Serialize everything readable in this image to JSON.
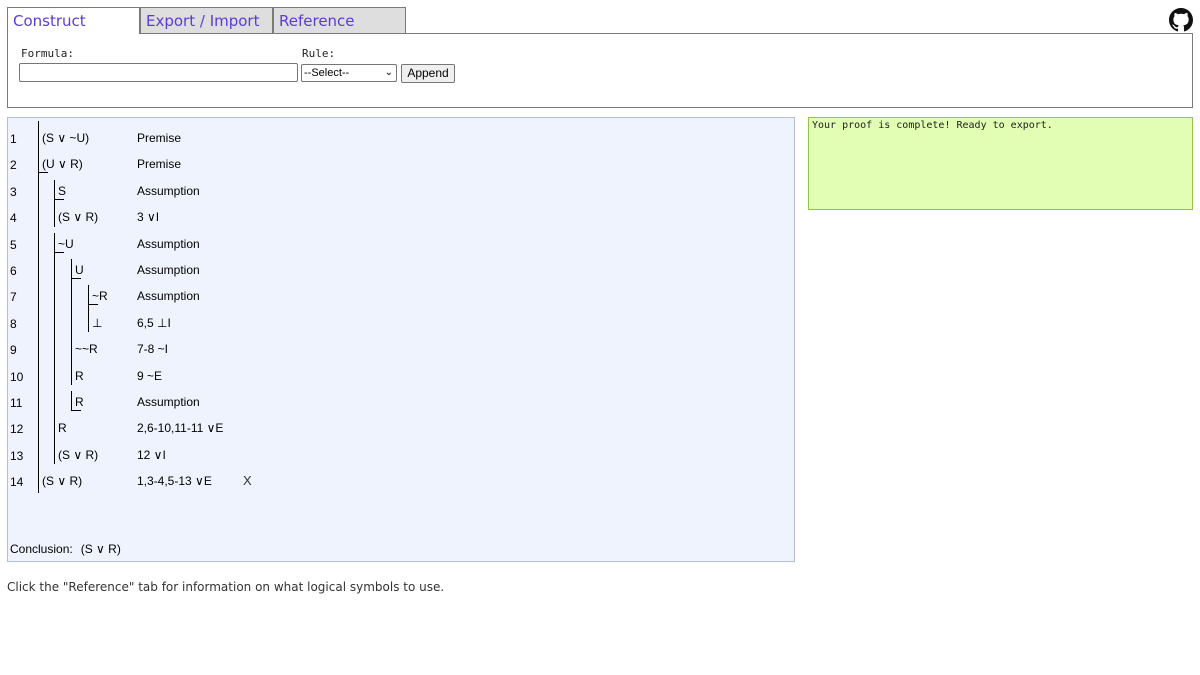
{
  "tabs": [
    {
      "label": "Construct",
      "active": true
    },
    {
      "label": "Export / Import",
      "active": false
    },
    {
      "label": "Reference",
      "active": false
    }
  ],
  "formula_panel": {
    "formula_label": "Formula:",
    "formula_value": "",
    "rule_label": "Rule:",
    "rule_selected": "--Select--",
    "append_label": "Append"
  },
  "proof": {
    "lines": [
      {
        "num": "1",
        "formula": "(S ∨ ~U)",
        "just": "Premise"
      },
      {
        "num": "2",
        "formula": "(U ∨ R)",
        "just": "Premise"
      },
      {
        "num": "3",
        "formula": "S",
        "just": "Assumption"
      },
      {
        "num": "4",
        "formula": "(S ∨ R)",
        "just": "3 ∨I"
      },
      {
        "num": "5",
        "formula": "~U",
        "just": "Assumption"
      },
      {
        "num": "6",
        "formula": "U",
        "just": "Assumption"
      },
      {
        "num": "7",
        "formula": "~R",
        "just": "Assumption"
      },
      {
        "num": "8",
        "formula": "⊥",
        "just": "6,5 ⊥I"
      },
      {
        "num": "9",
        "formula": "~~R",
        "just": "7-8 ~I"
      },
      {
        "num": "10",
        "formula": "R",
        "just": "9 ~E"
      },
      {
        "num": "11",
        "formula": "R",
        "just": "Assumption"
      },
      {
        "num": "12",
        "formula": "R",
        "just": "2,6-10,11-11 ∨E"
      },
      {
        "num": "13",
        "formula": "(S ∨ R)",
        "just": "12 ∨I"
      },
      {
        "num": "14",
        "formula": "(S ∨ R)",
        "just": "1,3-4,5-13 ∨E",
        "mark": "X"
      }
    ],
    "conclusion_label": "Conclusion:",
    "conclusion_value": "(S ∨ R)"
  },
  "status": {
    "message": "Your proof is complete! Ready to export.",
    "color": "#e2fdb4"
  },
  "footer": {
    "note": "Click the \"Reference\" tab for information on what logical symbols to use."
  },
  "icons": {
    "github": "github-icon"
  }
}
